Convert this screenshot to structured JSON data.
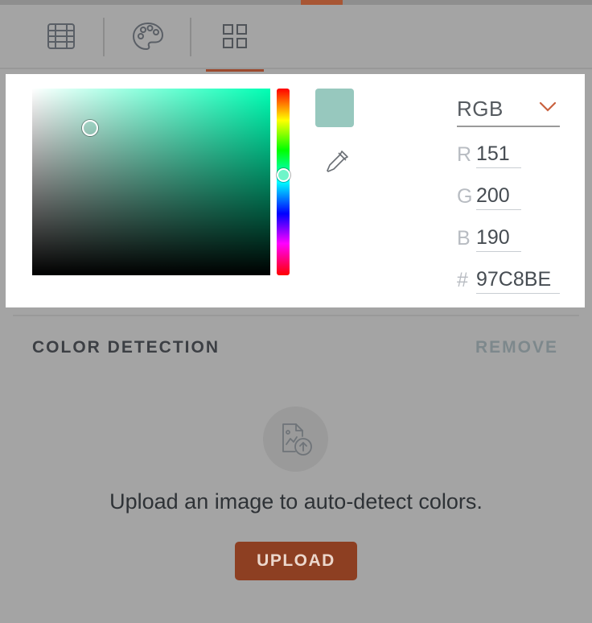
{
  "colors": {
    "accent": "#9c4a2e",
    "overlay_bg": "#a4a4a4",
    "hue": "#00ffb4",
    "current": "#97C8BE"
  },
  "tabs": [
    {
      "icon": "table-grid-icon",
      "selected": false
    },
    {
      "icon": "palette-icon",
      "selected": false
    },
    {
      "icon": "four-squares-icon",
      "selected": true
    }
  ],
  "picker": {
    "mode": "RGB",
    "channels": {
      "r_label": "R",
      "r_value": "151",
      "g_label": "G",
      "g_value": "200",
      "b_label": "B",
      "b_value": "190",
      "hex_label": "#",
      "hex_value": "97C8BE"
    },
    "icons": {
      "eyedropper": "eyedropper-icon",
      "dropdown": "chevron-down-icon"
    }
  },
  "color_detection": {
    "title": "COLOR DETECTION",
    "remove_label": "REMOVE",
    "upload_icon": "image-upload-icon",
    "message": "Upload an image to auto-detect colors.",
    "upload_label": "UPLOAD"
  }
}
